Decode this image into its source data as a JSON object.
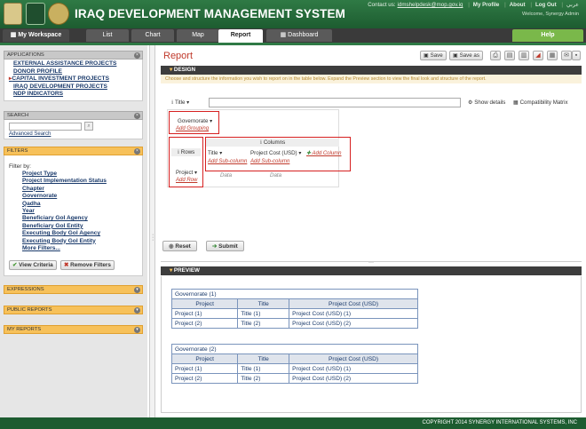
{
  "header": {
    "title": "IRAQ DEVELOPMENT MANAGEMENT SYSTEM",
    "contact_label": "Contact us:",
    "contact_email": "idmshelpdesk@mop.gov.iq",
    "my_profile": "My Profile",
    "about": "About",
    "logout": "Log Out",
    "language": "عربي",
    "welcome": "Welcome, Synergy Admin"
  },
  "nav": {
    "workspace": "My Workspace",
    "list": "List",
    "chart": "Chart",
    "map": "Map",
    "report": "Report",
    "dashboard": "Dashboard",
    "help": "Help"
  },
  "sidebar": {
    "applications_title": "APPLICATIONS",
    "applications": [
      "EXTERNAL ASSISTANCE PROJECTS",
      "DONOR PROFILE",
      "CAPITAL INVESTMENT PROJECTS",
      "IRAQ DEVELOPMENT PROJECTS",
      "NDP INDICATORS"
    ],
    "search_title": "SEARCH",
    "advanced_search": "Advanced Search",
    "filters_title": "FILTERS",
    "filter_by": "Filter by:",
    "filters": [
      "Project Type",
      "Project Implementation Status",
      "Chapter",
      "Governorate",
      "Qadha",
      "Year",
      "Beneficiary GoI Agency",
      "Beneficiary GoI Entity",
      "Executing Body GoI Agency",
      "Executing Body GoI Entity",
      "More Filters..."
    ],
    "view_criteria": "View Criteria",
    "remove_filters": "Remove Filters",
    "expressions": "EXPRESSIONS",
    "public_reports": "PUBLIC REPORTS",
    "my_reports": "MY REPORTS"
  },
  "main": {
    "title": "Report",
    "toolbar": {
      "save": "Save",
      "save_as": "Save as"
    },
    "design_title": "DESIGN",
    "design_note": "Choose and structure the information you wish to report on in the table below. Expand the Preview section to view the final look and structure of the report.",
    "title_field_label": "Title",
    "show_details": "Show details",
    "compat_matrix": "Compatibility Matrix",
    "grouping_field": "Governorate",
    "add_grouping": "Add Grouping",
    "rows_label": "Rows",
    "columns_label": "Columns",
    "row_field": "Project",
    "add_row": "Add Row",
    "col1": "Title",
    "col2": "Project Cost (USD)",
    "add_column": "Add Column",
    "add_subcolumn": "Add Sub-column",
    "data_cell": "Data",
    "reset": "Reset",
    "submit": "Submit",
    "preview_title": "PREVIEW"
  },
  "preview": {
    "headers": [
      "Project",
      "Title",
      "Project Cost (USD)"
    ],
    "groups": [
      {
        "name": "Governorate (1)",
        "rows": [
          [
            "Project (1)",
            "Title (1)",
            "Project Cost (USD) (1)"
          ],
          [
            "Project (2)",
            "Title (2)",
            "Project Cost (USD) (2)"
          ]
        ]
      },
      {
        "name": "Governorate (2)",
        "rows": [
          [
            "Project (1)",
            "Title (1)",
            "Project Cost (USD) (1)"
          ],
          [
            "Project (2)",
            "Title (2)",
            "Project Cost (USD) (2)"
          ]
        ]
      }
    ]
  },
  "footer": {
    "copyright": "COPYRIGHT 2014 SYNERGY INTERNATIONAL SYSTEMS, INC"
  },
  "colors": {
    "brand_green": "#2f7a45",
    "accent_red": "#c0392b",
    "help_green": "#7ab84a"
  }
}
